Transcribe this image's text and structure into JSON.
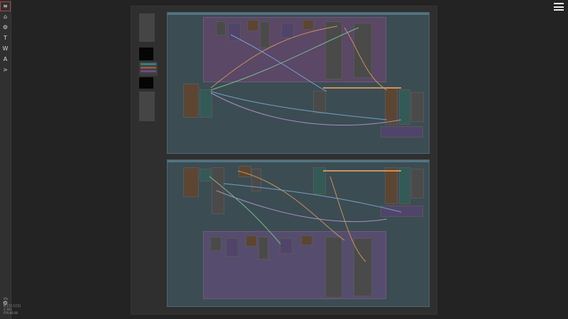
{
  "sidebar": {
    "buttons": [
      {
        "icon": "hamburger-icon",
        "glyph": "≡"
      },
      {
        "icon": "home-icon",
        "glyph": "⌂"
      },
      {
        "icon": "gear-icon",
        "glyph": "⚙"
      },
      {
        "icon": "text-icon",
        "glyph": "T"
      },
      {
        "icon": "word-icon",
        "glyph": "W"
      },
      {
        "icon": "letter-a-icon",
        "glyph": "A"
      },
      {
        "icon": "prompt-icon",
        "glyph": ">"
      }
    ],
    "footer": {
      "settings_glyph": "⚙",
      "status_lines": [
        "0%",
        "N 172 [172]",
        "V 363",
        "FPS:60.00"
      ]
    }
  },
  "header": {
    "menu_icon": "hamburger-icon"
  },
  "colors": {
    "group_bg": "#3c4c53",
    "subgroup_bg": "#5b4766",
    "wire_orange": "#e0a060",
    "wire_blue": "#7ab0d8",
    "wire_green": "#7dcf9a",
    "wire_purple": "#b99ad8"
  }
}
